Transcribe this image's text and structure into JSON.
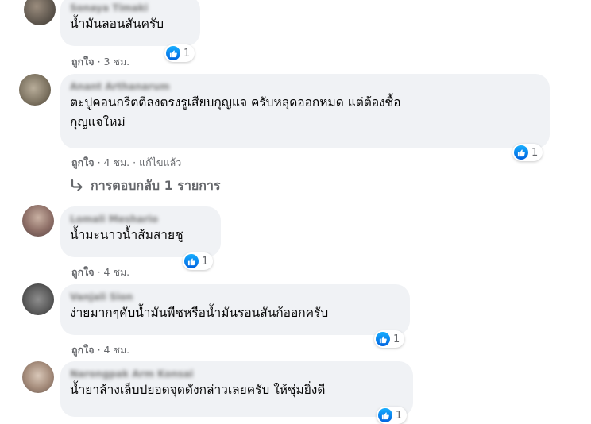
{
  "comments": [
    {
      "author": "Sonaya Timaki",
      "text": [
        "น้ำมันลอนสันครับ"
      ],
      "likes": "1",
      "meta": {
        "like": "ถูกใจ",
        "time": "3 ชม.",
        "edited": ""
      }
    },
    {
      "author": "Anant Arthanarum",
      "text": [
        "ตะปูคอนกรีตตีลงตรงรูเสียบกุญแจ ครับหลุดออกหมด แต่ต้องซื้อ",
        "กุญแจใหม่"
      ],
      "likes": "1",
      "meta": {
        "like": "ถูกใจ",
        "time": "4 ชม.",
        "edited": "แก้ไขแล้ว"
      }
    },
    {
      "author": "Lomali Meshario",
      "text": [
        "น้ำมะนาวน้ำส้มสายชู"
      ],
      "likes": "1",
      "meta": {
        "like": "ถูกใจ",
        "time": "4 ชม.",
        "edited": ""
      }
    },
    {
      "author": "Vanjali Sion",
      "text": [
        "ง่ายมากๆคับน้ำมันพืชหรือน้ำมันรอนสันก้ออกครับ"
      ],
      "likes": "1",
      "meta": {
        "like": "ถูกใจ",
        "time": "4 ชม.",
        "edited": ""
      }
    },
    {
      "author": "Narongpak Arm Konsai",
      "text": [
        "น้ำยาล้างเล็บปยอดจุดดังกล่าวเลยครับ ให้ชุ่มยิ่งดี"
      ],
      "likes": "1",
      "meta": {
        "like": "",
        "time": "",
        "edited": ""
      }
    }
  ],
  "replies_link": "การตอบกลับ 1 รายการ",
  "separator": "·",
  "colors": {
    "like_blue": "#1877f2",
    "bubble": "#f0f2f5",
    "meta": "#65676b"
  },
  "icons": {
    "reaction": "like-icon",
    "reply": "reply-arrow-icon"
  }
}
